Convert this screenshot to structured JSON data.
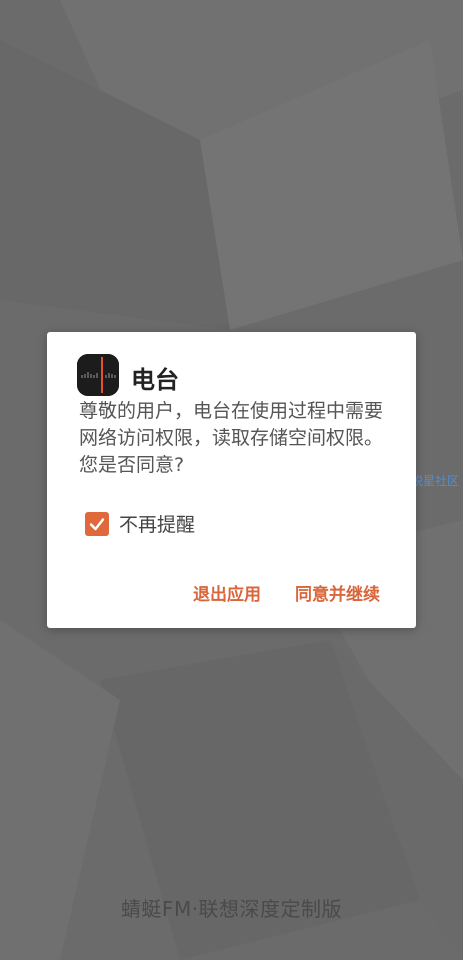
{
  "background": {
    "color": "#6d6d6d"
  },
  "footer": {
    "text": "蜻蜓FM·联想深度定制版"
  },
  "watermark": {
    "text": "锐星社区"
  },
  "dialog": {
    "app_icon": "radio-app-icon",
    "title": "电台",
    "message": "尊敬的用户，电台在使用过程中需要网络访问权限，读取存储空间权限。您是否同意?",
    "checkbox": {
      "label": "不再提醒",
      "checked": true,
      "icon": "check-icon"
    },
    "buttons": {
      "exit_label": "退出应用",
      "agree_label": "同意并继续"
    },
    "accent_color": "#e0693c"
  }
}
